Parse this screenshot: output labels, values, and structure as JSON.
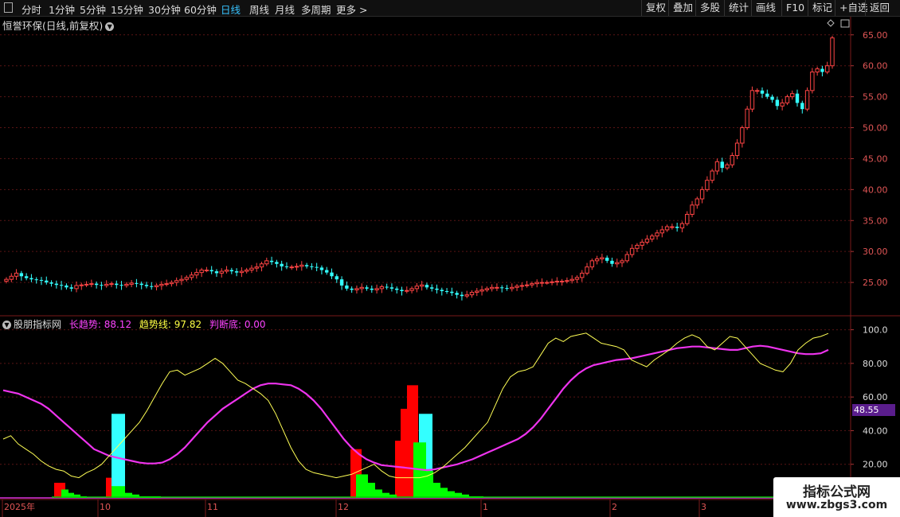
{
  "toolbar": {
    "periods": [
      {
        "label": "分时"
      },
      {
        "label": "1分钟"
      },
      {
        "label": "5分钟"
      },
      {
        "label": "15分钟"
      },
      {
        "label": "30分钟"
      },
      {
        "label": "60分钟"
      },
      {
        "label": "日线",
        "active": true
      },
      {
        "label": "周线"
      },
      {
        "label": "月线"
      },
      {
        "label": "多周期"
      },
      {
        "label": "更多 >"
      }
    ],
    "right": [
      {
        "label": "复权"
      },
      {
        "label": "叠加"
      },
      {
        "label": "多股"
      },
      {
        "label": "统计"
      },
      {
        "label": "画线"
      },
      {
        "label": "F10"
      },
      {
        "label": "标记"
      },
      {
        "label": "+自选"
      },
      {
        "label": "返回"
      }
    ]
  },
  "main_chart": {
    "title": "恒誉环保(日线,前复权)",
    "price_ticks": [
      "65.00",
      "60.00",
      "55.00",
      "50.00",
      "45.00",
      "40.00",
      "35.00",
      "30.00",
      "25.00"
    ],
    "up_color": "#ff4444",
    "down_color": "#33ffff"
  },
  "indicator": {
    "name": "股朋指标网",
    "long_trend_label": "长趋势:",
    "long_trend_value": "88.12",
    "trend_line_label": "趋势线:",
    "trend_line_value": "97.82",
    "bottom_label": "判断底:",
    "bottom_value": "0.00",
    "ticks": [
      "100.0",
      "80.00",
      "60.00",
      "40.00",
      "20.00"
    ],
    "badge": "48.55"
  },
  "time_axis": [
    "2025年",
    "10",
    "11",
    "12",
    "1",
    "2",
    "3"
  ],
  "watermark": {
    "line1": "指标公式网",
    "line2": "www.zbgs3.com"
  },
  "chart_data": [
    {
      "type": "candlestick",
      "title": "恒誉环保(日线,前复权)",
      "ylim": [
        20,
        66
      ],
      "series": [
        {
          "values": [
            25.5,
            26.0,
            26.5,
            26.0,
            25.7,
            25.5,
            25.4,
            25.3,
            25.0,
            24.8,
            24.6,
            24.5,
            24.2,
            24.0,
            24.5,
            24.6,
            24.7,
            24.8,
            24.6,
            24.5,
            24.7,
            24.8,
            24.6,
            24.5,
            24.7,
            24.9,
            24.8,
            24.6,
            24.4,
            24.3,
            24.5,
            24.7,
            24.8,
            25.0,
            25.3,
            25.5,
            25.8,
            26.2,
            26.6,
            27.0,
            27.0,
            26.8,
            26.5,
            26.8,
            27.0,
            26.8,
            26.6,
            26.8,
            27.0,
            27.3,
            27.5,
            28.0,
            28.5,
            28.3,
            28.0,
            27.6,
            27.5,
            27.5,
            27.6,
            27.8,
            27.6,
            27.5,
            27.4,
            27.0,
            26.6,
            26.0,
            25.5,
            24.5,
            24.0,
            23.8,
            24.0,
            24.2,
            24.0,
            23.8,
            24.0,
            24.3,
            24.2,
            24.0,
            23.8,
            23.6,
            23.7,
            24.0,
            24.4,
            24.6,
            24.2,
            24.0,
            23.8,
            23.6,
            23.5,
            23.3,
            23.0,
            22.8,
            23.0,
            23.4,
            23.6,
            23.8,
            24.0,
            24.2,
            24.2,
            24.1,
            24.0,
            24.2,
            24.4,
            24.5,
            24.6,
            24.8,
            25.0,
            25.0,
            25.0,
            25.1,
            25.2,
            25.2,
            25.3,
            25.5,
            25.8,
            26.5,
            27.5,
            28.5,
            28.8,
            29.0,
            28.5,
            28.0,
            28.2,
            28.5,
            29.5,
            30.5,
            31.0,
            31.5,
            32.0,
            32.5,
            33.0,
            33.5,
            34.0,
            34.0,
            33.8,
            34.5,
            36.0,
            37.5,
            38.5,
            40.0,
            41.5,
            43.0,
            44.5,
            43.5,
            44.0,
            45.5,
            47.5,
            50.0,
            53.0,
            56.0,
            56.0,
            55.5,
            55.0,
            54.5,
            53.5,
            54.0,
            55.0,
            55.5,
            54.0,
            53.0,
            56.0,
            59.0,
            59.5,
            59.0,
            60.0,
            64.5
          ]
        }
      ]
    },
    {
      "type": "line",
      "ylim": [
        0,
        105
      ],
      "series": [
        {
          "name": "长趋势",
          "values": [
            64.0,
            63.0,
            62.0,
            60.0,
            58.0,
            56.0,
            53.0,
            49.0,
            45.0,
            41.0,
            37.0,
            33.0,
            29.0,
            27.0,
            25.0,
            24.0,
            23.0,
            22.0,
            21.0,
            20.5,
            20.5,
            21.0,
            23.0,
            26.0,
            30.0,
            35.0,
            40.0,
            45.0,
            49.0,
            53.0,
            56.0,
            59.0,
            62.0,
            65.0,
            67.0,
            68.0,
            68.0,
            67.5,
            67.0,
            65.0,
            62.0,
            58.0,
            53.0,
            47.0,
            41.0,
            35.0,
            30.0,
            26.0,
            23.0,
            21.0,
            19.5,
            19.0,
            18.5,
            18.0,
            17.5,
            17.0,
            16.5,
            17.0,
            18.0,
            19.0,
            20.0,
            21.5,
            23.0,
            25.0,
            27.0,
            29.0,
            31.0,
            33.0,
            35.0,
            38.0,
            42.0,
            47.0,
            53.0,
            59.0,
            65.0,
            70.0,
            74.0,
            77.0,
            79.0,
            80.0,
            81.0,
            82.0,
            82.5,
            83.0,
            84.0,
            85.0,
            86.0,
            87.0,
            88.0,
            89.0,
            89.5,
            90.0,
            90.0,
            89.5,
            89.0,
            88.5,
            88.0,
            88.0,
            89.0,
            90.0,
            90.5,
            90.0,
            89.0,
            88.0,
            87.0,
            86.0,
            85.5,
            85.5,
            86.0,
            88.0
          ]
        },
        {
          "name": "趋势线",
          "values": [
            35.0,
            37.0,
            32.0,
            29.0,
            26.0,
            22.0,
            19.0,
            17.0,
            16.0,
            13.0,
            12.0,
            15.0,
            17.0,
            20.0,
            25.0,
            30.0,
            35.0,
            40.0,
            45.0,
            52.0,
            60.0,
            68.0,
            75.0,
            76.0,
            73.0,
            75.0,
            77.0,
            80.0,
            83.0,
            80.0,
            75.0,
            70.0,
            68.0,
            65.0,
            62.0,
            58.0,
            50.0,
            40.0,
            30.0,
            22.0,
            17.0,
            15.0,
            14.0,
            13.0,
            12.0,
            13.0,
            14.0,
            16.0,
            18.0,
            20.0,
            16.0,
            13.0,
            12.0,
            12.0,
            12.0,
            12.0,
            13.0,
            15.0,
            18.0,
            22.0,
            26.0,
            30.0,
            35.0,
            40.0,
            45.0,
            55.0,
            65.0,
            72.0,
            75.0,
            76.0,
            78.0,
            85.0,
            92.0,
            95.0,
            93.0,
            96.0,
            97.0,
            98.0,
            95.0,
            92.0,
            91.0,
            90.0,
            88.0,
            82.0,
            80.0,
            78.0,
            82.0,
            85.0,
            88.0,
            92.0,
            95.0,
            97.0,
            95.0,
            90.0,
            88.0,
            92.0,
            96.0,
            95.0,
            90.0,
            85.0,
            80.0,
            78.0,
            76.0,
            75.0,
            80.0,
            88.0,
            92.0,
            95.0,
            96.0,
            97.8
          ]
        }
      ]
    }
  ]
}
